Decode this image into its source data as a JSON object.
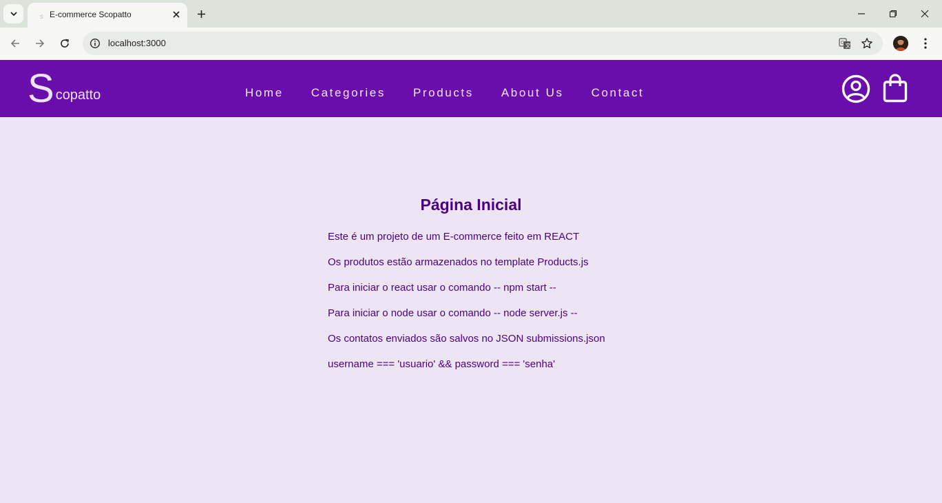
{
  "browser": {
    "tab_title": "E-commerce Scopatto",
    "url": "localhost:3000",
    "colors": {
      "tabbar": "#dde3da",
      "toolbar": "#f7f8f5"
    }
  },
  "site": {
    "logo_letter": "S",
    "logo_rest": "copatto",
    "nav": [
      "Home",
      "Categories",
      "Products",
      "About Us",
      "Contact"
    ],
    "icons": {
      "account": "user-circle-icon",
      "cart": "shopping-bag-icon"
    },
    "colors": {
      "header_bg": "#6a0dad",
      "page_bg": "#ede5f4",
      "text": "#4b0082"
    }
  },
  "main": {
    "heading": "Página Inicial",
    "lines": [
      "Este é um projeto de um E-commerce feito em REACT",
      "Os produtos estão armazenados no template Products.js",
      "Para iniciar o react usar o comando -- npm start --",
      "Para iniciar o node usar o comando -- node server.js --",
      "Os contatos enviados são salvos no JSON submissions.json",
      "username === 'usuario' && password === 'senha'"
    ]
  }
}
